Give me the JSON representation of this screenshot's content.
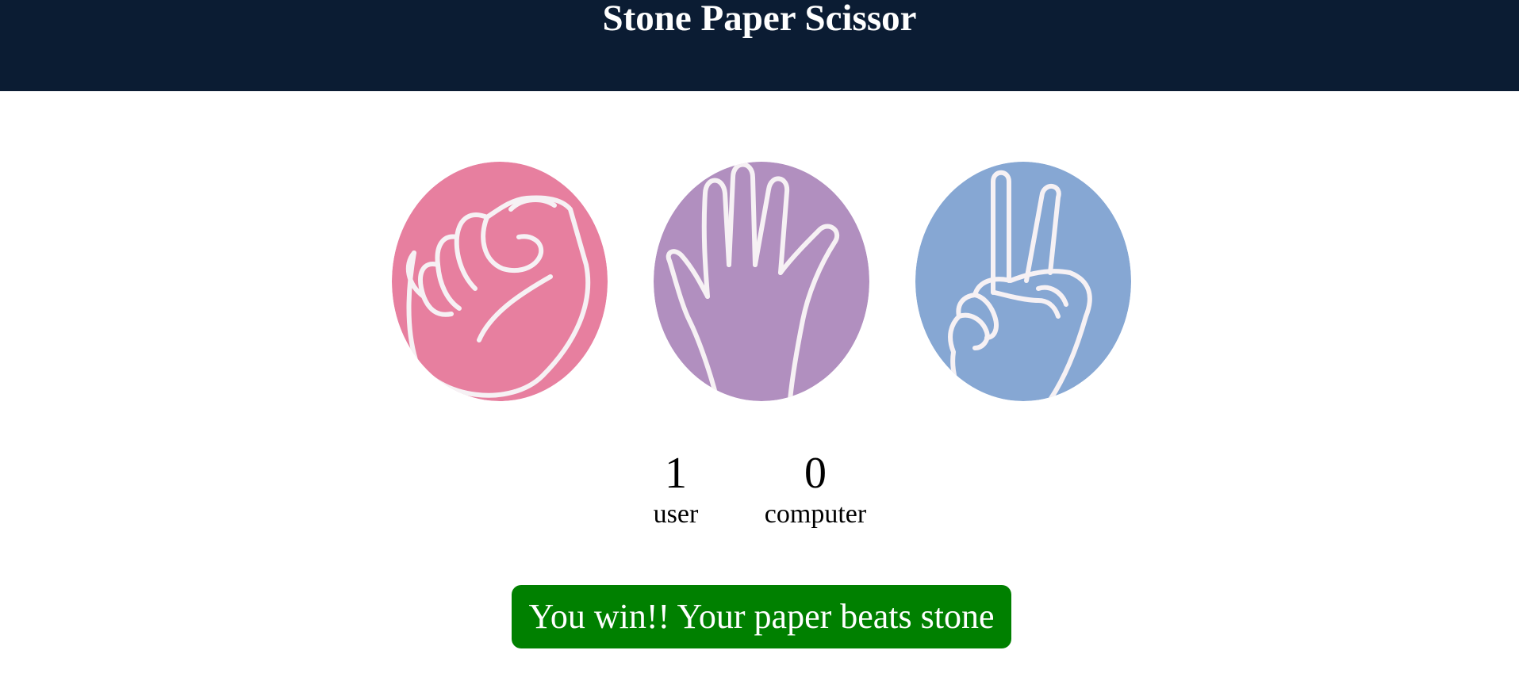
{
  "header": {
    "title": "Stone Paper Scissor"
  },
  "choices": [
    {
      "id": "stone",
      "icon": "fist-icon",
      "color": "#e77f9f"
    },
    {
      "id": "paper",
      "icon": "open-hand-icon",
      "color": "#b18fbf"
    },
    {
      "id": "scissor",
      "icon": "peace-hand-icon",
      "color": "#86a7d3"
    }
  ],
  "scoreboard": {
    "user": {
      "score": "1",
      "label": "user"
    },
    "computer": {
      "score": "0",
      "label": "computer"
    }
  },
  "message": {
    "text": "You win!! Your paper beats stone",
    "color": "#008000"
  },
  "colors": {
    "header_bg": "#0b1c33",
    "text": "#000000",
    "background": "#ffffff"
  }
}
